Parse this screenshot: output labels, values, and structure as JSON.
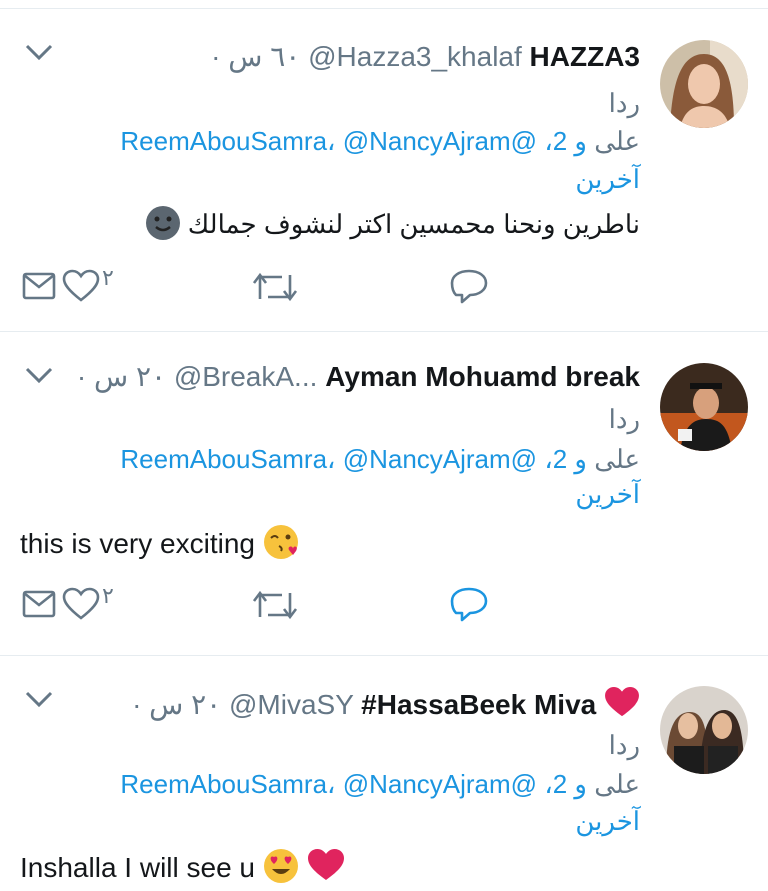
{
  "tweets": [
    {
      "name": "HAZZA3",
      "handle": "@Hazza3_khalaf",
      "time": "· ٦٠ س",
      "reply_label": "ردا",
      "reply_on": "على",
      "mention_1": "@ReemAbouSamra",
      "mention_2": "@NancyAjram",
      "others": "و 2",
      "others_cont": "آخرين",
      "text": "ناطرين ونحنا محمسين اكتر لنشوف جمالك",
      "emoji": "🙂",
      "like_count": "٢"
    },
    {
      "name": "Ayman Mohuamd break",
      "handle": "@BreakA...",
      "time": "· ٢٠ س",
      "reply_label": "ردا",
      "reply_on": "على",
      "mention_1": "@ReemAbouSamra",
      "mention_2": "@NancyAjram",
      "others": "و 2",
      "others_cont": "آخرين",
      "text": "this is very exciting",
      "emoji": "😘",
      "like_count": "٢"
    },
    {
      "name": "#HassaBeek Miva",
      "handle": "@MivaSY",
      "time": "· ٢٠ س",
      "reply_label": "ردا",
      "reply_on": "على",
      "mention_1": "@ReemAbouSamra",
      "mention_2": "@NancyAjram",
      "others": "و 2",
      "others_cont": "آخرين",
      "text": "Inshalla I will see u",
      "emoji": "😍",
      "like_count": ""
    }
  ],
  "icons": {
    "chevron": "chevron-down-icon",
    "dm": "envelope-icon",
    "like": "heart-icon",
    "retweet": "retweet-icon",
    "reply": "speech-bubble-icon"
  },
  "colors": {
    "link": "#1b95e0",
    "meta": "#657786",
    "text": "#14171a",
    "heart": "#e0245e"
  }
}
